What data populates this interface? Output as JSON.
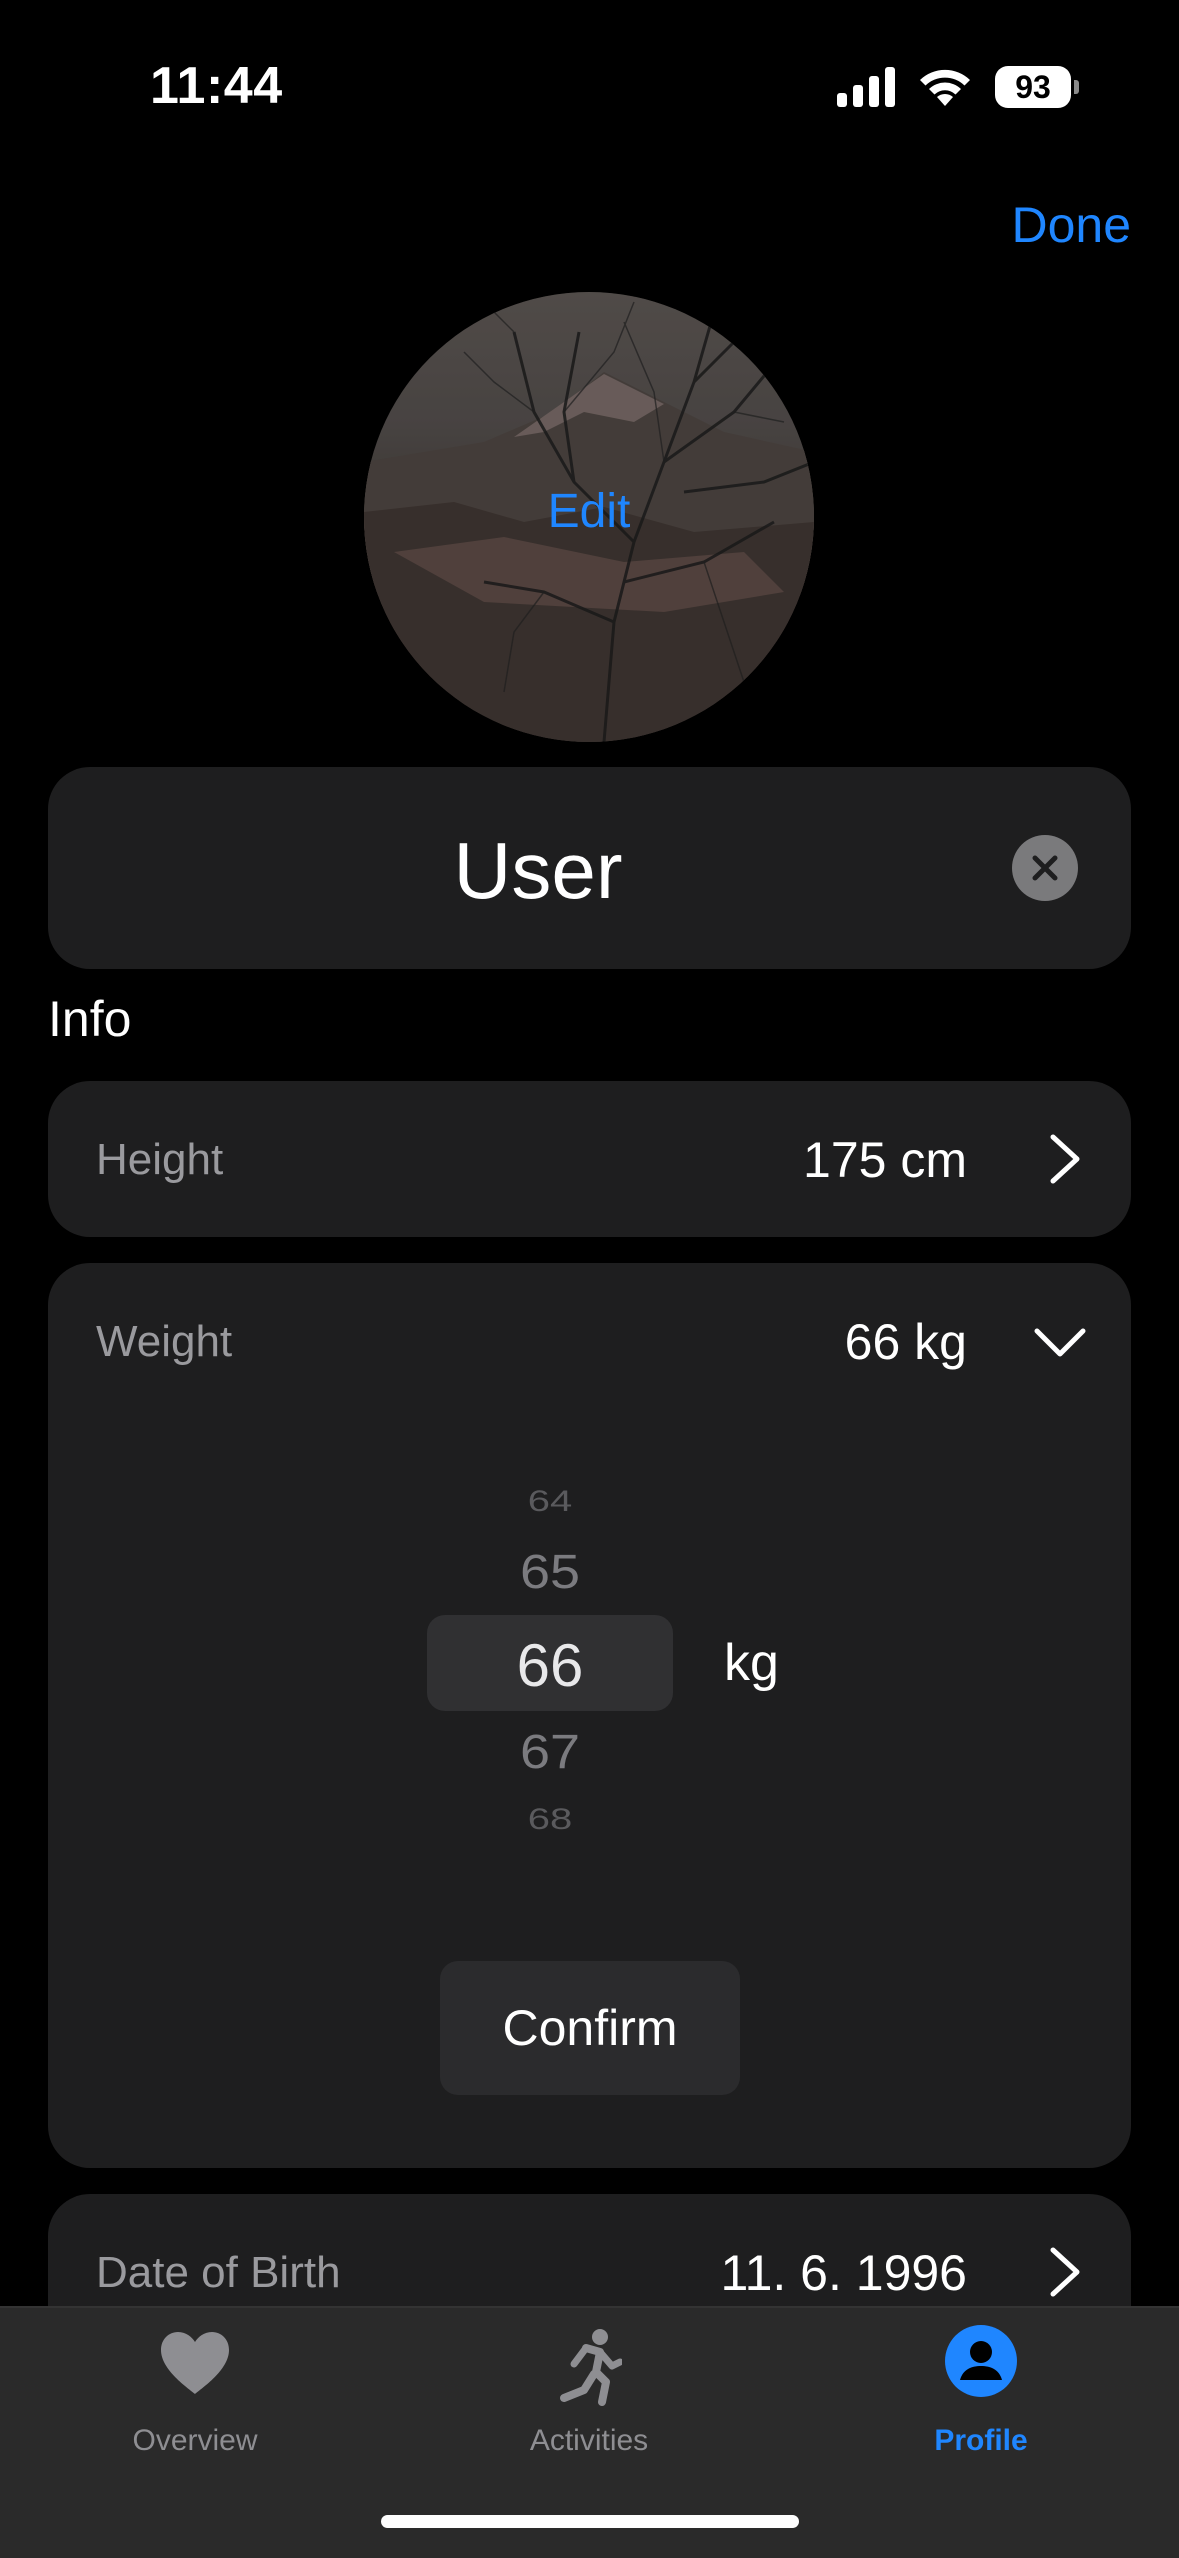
{
  "status_bar": {
    "time": "11:44",
    "battery_percent": "93",
    "icons": [
      "signal-icon",
      "wifi-icon",
      "battery-icon"
    ]
  },
  "header": {
    "done_label": "Done"
  },
  "avatar": {
    "edit_label": "Edit"
  },
  "profile": {
    "name": "User"
  },
  "info": {
    "section_title": "Info",
    "height": {
      "label": "Height",
      "value": "175 cm"
    },
    "weight": {
      "label": "Weight",
      "value": "66 kg",
      "picker": {
        "values": [
          "64",
          "65",
          "66",
          "67",
          "68"
        ],
        "selected": "66",
        "unit": "kg"
      },
      "confirm_label": "Confirm"
    },
    "date_of_birth": {
      "label": "Date of Birth",
      "value": "11. 6. 1996"
    }
  },
  "tab_bar": {
    "tabs": [
      {
        "label": "Overview",
        "icon": "heart-icon",
        "active": false
      },
      {
        "label": "Activities",
        "icon": "runner-icon",
        "active": false
      },
      {
        "label": "Profile",
        "icon": "person-circle-icon",
        "active": true
      }
    ]
  },
  "colors": {
    "accent": "#1f86ff",
    "background": "#000000",
    "card": "#1e1e1f",
    "secondary_text": "#9a9a9e"
  }
}
